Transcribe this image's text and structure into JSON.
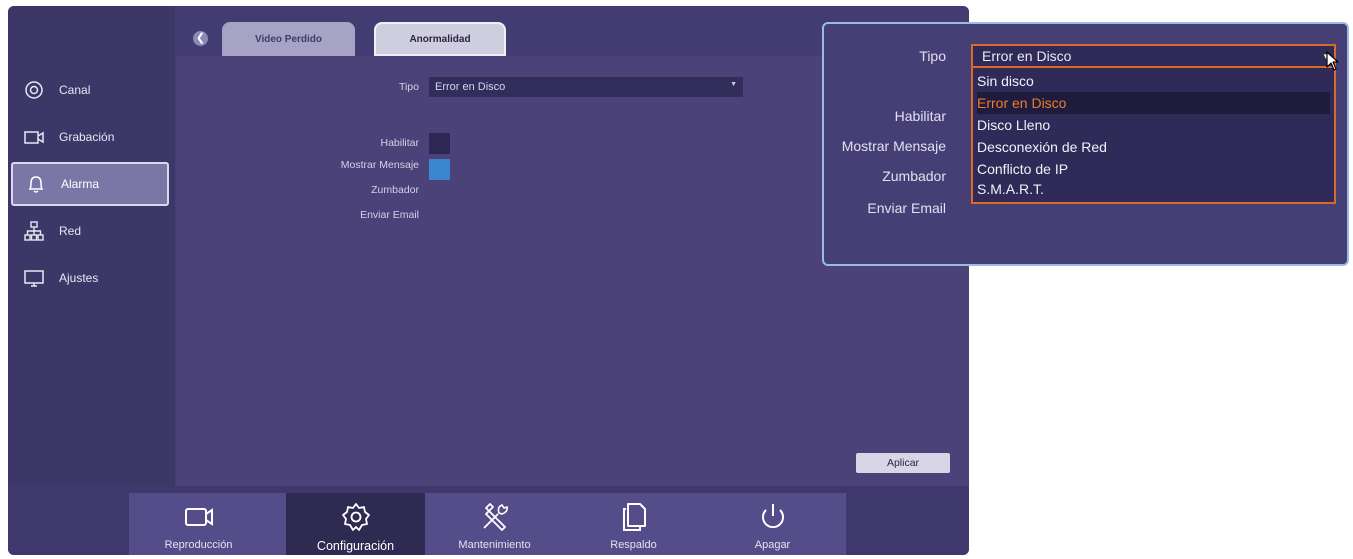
{
  "sidebar": {
    "items": [
      {
        "label": "Canal",
        "icon": "channel-icon"
      },
      {
        "label": "Grabación",
        "icon": "video-camera-icon"
      },
      {
        "label": "Alarma",
        "icon": "bell-icon",
        "active": true
      },
      {
        "label": "Red",
        "icon": "network-icon"
      },
      {
        "label": "Ajustes",
        "icon": "monitor-icon"
      }
    ]
  },
  "tabs": [
    {
      "label": "Video Perdido"
    },
    {
      "label": "Anormalidad",
      "active": true
    }
  ],
  "form": {
    "tipo_label": "Tipo",
    "tipo_value": "Error en Disco",
    "habilitar_label": "Habilitar",
    "mensaje_label": "Mostrar Mensaje",
    "zumbador_label": "Zumbador",
    "email_label": "Enviar Email",
    "habilitar_checked": false,
    "mensaje_checked": true
  },
  "aplicar_label": "Aplicar",
  "dock": [
    {
      "label": "Reproducción",
      "icon": "video-camera-icon"
    },
    {
      "label": "Configuración",
      "icon": "gear-icon",
      "active": true
    },
    {
      "label": "Mantenimiento",
      "icon": "tools-icon"
    },
    {
      "label": "Respaldo",
      "icon": "copy-icon"
    },
    {
      "label": "Apagar",
      "icon": "power-icon"
    }
  ],
  "zoom": {
    "tipo_label": "Tipo",
    "tipo_value": "Error en Disco",
    "habilitar_label": "Habilitar",
    "mensaje_label": "Mostrar Mensaje",
    "zumbador_label": "Zumbador",
    "email_label": "Enviar Email",
    "options": [
      "Sin disco",
      "Error en Disco",
      "Disco Lleno",
      "Desconexión de Red",
      "Conflicto de IP",
      "S.M.A.R.T."
    ],
    "selected_index": 1
  },
  "colors": {
    "background": "#463f76",
    "sidebar": "#3d3768",
    "highlight_orange": "#f07a2d",
    "checkbox_blue": "#3b86cf",
    "zoom_border": "#9bbbe0"
  }
}
